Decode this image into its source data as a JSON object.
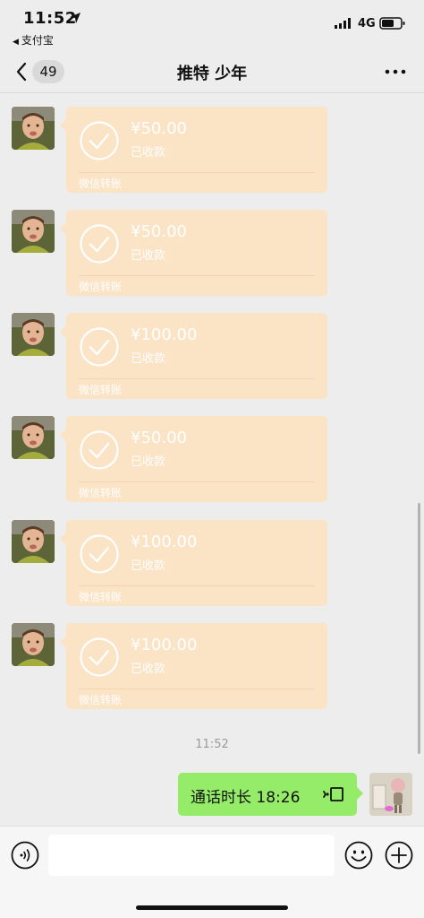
{
  "status_bar": {
    "time": "11:52",
    "back_app": "支付宝",
    "network": "4G"
  },
  "nav": {
    "unread_count": "49",
    "title": "推特 少年"
  },
  "messages": [
    {
      "amount": "¥50.00",
      "status": "已收款",
      "label": "微信转账"
    },
    {
      "amount": "¥50.00",
      "status": "已收款",
      "label": "微信转账"
    },
    {
      "amount": "¥100.00",
      "status": "已收款",
      "label": "微信转账"
    },
    {
      "amount": "¥50.00",
      "status": "已收款",
      "label": "微信转账"
    },
    {
      "amount": "¥100.00",
      "status": "已收款",
      "label": "微信转账"
    },
    {
      "amount": "¥100.00",
      "status": "已收款",
      "label": "微信转账"
    }
  ],
  "timestamp": "11:52",
  "call": {
    "text": "通话时长 18:26"
  },
  "colors": {
    "transfer_card": "#fbe3c5",
    "call_bubble": "#95ec69",
    "background": "#ededed"
  }
}
